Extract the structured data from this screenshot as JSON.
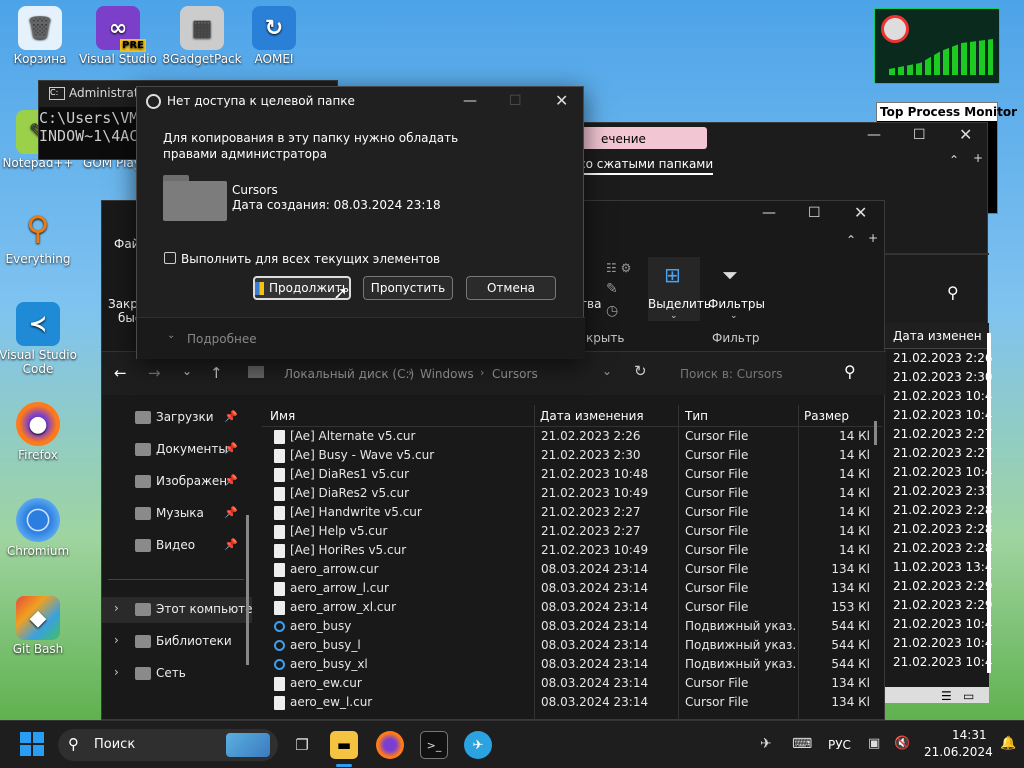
{
  "desktop_icons": [
    {
      "label": "Корзина",
      "icon": "recycle-bin-icon"
    },
    {
      "label": "Visual Studio",
      "badge": "PRE",
      "icon": "visual-studio-icon"
    },
    {
      "label": "8GadgetPack",
      "icon": "gadgetpack-icon"
    },
    {
      "label": "AOMEI",
      "icon": "aomei-icon"
    },
    {
      "label": "Notepad++",
      "icon": "notepadpp-icon"
    },
    {
      "label": "GOM Play",
      "icon": "gom-icon"
    },
    {
      "label": "Everything",
      "icon": "everything-icon"
    },
    {
      "label": "Visual Studio Code",
      "icon": "vscode-icon"
    },
    {
      "label": "Firefox",
      "icon": "firefox-icon"
    },
    {
      "label": "Chromium",
      "icon": "chromium-icon"
    },
    {
      "label": "Git Bash",
      "icon": "git-bash-icon"
    }
  ],
  "cmd": {
    "title": "Administrato",
    "line1": "C:\\Users\\VM6",
    "line2": "INDOW~1\\4AC8"
  },
  "widget": {
    "title": "Top Process Monitor"
  },
  "bg_explorer": {
    "pink_text": "ечение",
    "menu_text": "со сжатыми папками"
  },
  "dialog": {
    "title": "Нет доступа к целевой папке",
    "message": "Для копирования в эту папку нужно обладать правами администратора",
    "folder_name": "Cursors",
    "folder_date": "Дата создания: 08.03.2024 23:18",
    "checkbox_label": "Выполнить для всех текущих элементов",
    "continue": "Продолжить",
    "skip": "Пропустить",
    "cancel": "Отмена",
    "details": "Подробнее"
  },
  "explorer": {
    "menu_file": "Файл",
    "ribbon": {
      "select": "Выделить",
      "filters": "Фильтры",
      "filter_group": "Фильтр",
      "open_group": "крыть",
      "close_part": "Закр",
      "close_part2": "быс",
      "properties_part": "тва"
    },
    "breadcrumb": [
      "Локальный диск (C:)",
      "Windows",
      "Cursors"
    ],
    "search_placeholder": "Поиск в: Cursors",
    "nav": [
      {
        "label": "Загрузки",
        "pin": true
      },
      {
        "label": "Документы",
        "pin": true
      },
      {
        "label": "Изображен",
        "pin": true
      },
      {
        "label": "Музыка",
        "pin": true
      },
      {
        "label": "Видео",
        "pin": true
      },
      {
        "label": "Этот компьюте",
        "expand": true
      },
      {
        "label": "Библиотеки",
        "expand": true
      },
      {
        "label": "Сеть",
        "expand": true
      }
    ],
    "columns": {
      "name": "Имя",
      "date": "Дата изменения",
      "type": "Тип",
      "size": "Размер"
    },
    "files": [
      {
        "name": "[Ae] Alternate v5.cur",
        "date": "21.02.2023 2:26",
        "type": "Cursor File",
        "size": "14 Кl"
      },
      {
        "name": "[Ae] Busy - Wave v5.cur",
        "date": "21.02.2023 2:30",
        "type": "Cursor File",
        "size": "14 Кl"
      },
      {
        "name": "[Ae] DiaRes1 v5.cur",
        "date": "21.02.2023 10:48",
        "type": "Cursor File",
        "size": "14 Кl"
      },
      {
        "name": "[Ae] DiaRes2 v5.cur",
        "date": "21.02.2023 10:49",
        "type": "Cursor File",
        "size": "14 Кl"
      },
      {
        "name": "[Ae] Handwrite v5.cur",
        "date": "21.02.2023 2:27",
        "type": "Cursor File",
        "size": "14 Кl"
      },
      {
        "name": "[Ae] Help v5.cur",
        "date": "21.02.2023 2:27",
        "type": "Cursor File",
        "size": "14 Кl"
      },
      {
        "name": "[Ae] HoriRes v5.cur",
        "date": "21.02.2023 10:49",
        "type": "Cursor File",
        "size": "14 Кl"
      },
      {
        "name": "aero_arrow.cur",
        "date": "08.03.2024 23:14",
        "type": "Cursor File",
        "size": "134 Кl"
      },
      {
        "name": "aero_arrow_l.cur",
        "date": "08.03.2024 23:14",
        "type": "Cursor File",
        "size": "134 Кl"
      },
      {
        "name": "aero_arrow_xl.cur",
        "date": "08.03.2024 23:14",
        "type": "Cursor File",
        "size": "153 Кl"
      },
      {
        "name": "aero_busy",
        "date": "08.03.2024 23:14",
        "type": "Подвижный указ...",
        "size": "544 Кl",
        "busy": true
      },
      {
        "name": "aero_busy_l",
        "date": "08.03.2024 23:14",
        "type": "Подвижный указ...",
        "size": "544 Кl",
        "busy": true
      },
      {
        "name": "aero_busy_xl",
        "date": "08.03.2024 23:14",
        "type": "Подвижный указ...",
        "size": "544 Кl",
        "busy": true
      },
      {
        "name": "aero_ew.cur",
        "date": "08.03.2024 23:14",
        "type": "Cursor File",
        "size": "134 Кl"
      },
      {
        "name": "aero_ew_l.cur",
        "date": "08.03.2024 23:14",
        "type": "Cursor File",
        "size": "134 Кl"
      }
    ]
  },
  "right_panel": {
    "header": "Дата изменен",
    "dates": [
      "21.02.2023 2:26",
      "21.02.2023 2:30",
      "21.02.2023 10:4",
      "21.02.2023 10:4",
      "21.02.2023 2:27",
      "21.02.2023 2:27",
      "21.02.2023 10:4",
      "21.02.2023 2:31",
      "21.02.2023 2:28",
      "21.02.2023 2:28",
      "21.02.2023 2:28",
      "11.02.2023 13:4",
      "21.02.2023 2:29",
      "21.02.2023 2:29",
      "21.02.2023 10:4",
      "21.02.2023 10:4",
      "21.02.2023 10:4"
    ]
  },
  "taskbar": {
    "search": "Поиск",
    "lang": "РУС",
    "time": "14:31",
    "date": "21.06.2024"
  }
}
